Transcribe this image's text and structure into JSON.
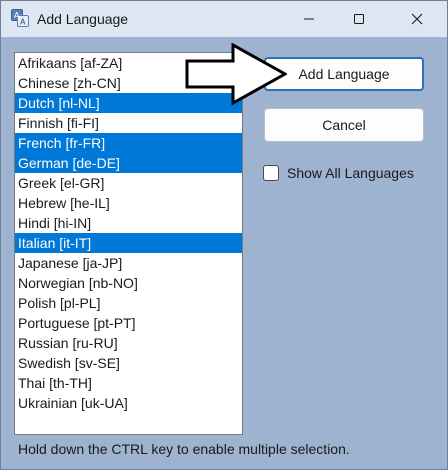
{
  "window": {
    "title": "Add Language"
  },
  "titlebar": {
    "icon": "translate-app-icon",
    "minimize_icon": "minimize-icon",
    "maximize_icon": "maximize-icon",
    "close_icon": "close-icon"
  },
  "language_list": {
    "items": [
      {
        "label": "Afrikaans [af-ZA]",
        "selected": false
      },
      {
        "label": "Chinese [zh-CN]",
        "selected": false
      },
      {
        "label": "Dutch [nl-NL]",
        "selected": true
      },
      {
        "label": "Finnish [fi-FI]",
        "selected": false
      },
      {
        "label": "French [fr-FR]",
        "selected": true
      },
      {
        "label": "German [de-DE]",
        "selected": true
      },
      {
        "label": "Greek [el-GR]",
        "selected": false
      },
      {
        "label": "Hebrew [he-IL]",
        "selected": false
      },
      {
        "label": "Hindi [hi-IN]",
        "selected": false
      },
      {
        "label": "Italian [it-IT]",
        "selected": true
      },
      {
        "label": "Japanese [ja-JP]",
        "selected": false
      },
      {
        "label": "Norwegian [nb-NO]",
        "selected": false
      },
      {
        "label": "Polish [pl-PL]",
        "selected": false
      },
      {
        "label": "Portuguese [pt-PT]",
        "selected": false
      },
      {
        "label": "Russian [ru-RU]",
        "selected": false
      },
      {
        "label": "Swedish [sv-SE]",
        "selected": false
      },
      {
        "label": "Thai [th-TH]",
        "selected": false
      },
      {
        "label": "Ukrainian [uk-UA]",
        "selected": false
      }
    ]
  },
  "buttons": {
    "add_label": "Add Language",
    "cancel_label": "Cancel"
  },
  "show_all": {
    "label": "Show All Languages",
    "checked": false
  },
  "hint_text": "Hold down the CTRL key to enable multiple selection.",
  "colors": {
    "selection": "#0078d7",
    "window_bg": "#9db3cf",
    "titlebar_bg": "#dde6f1"
  }
}
